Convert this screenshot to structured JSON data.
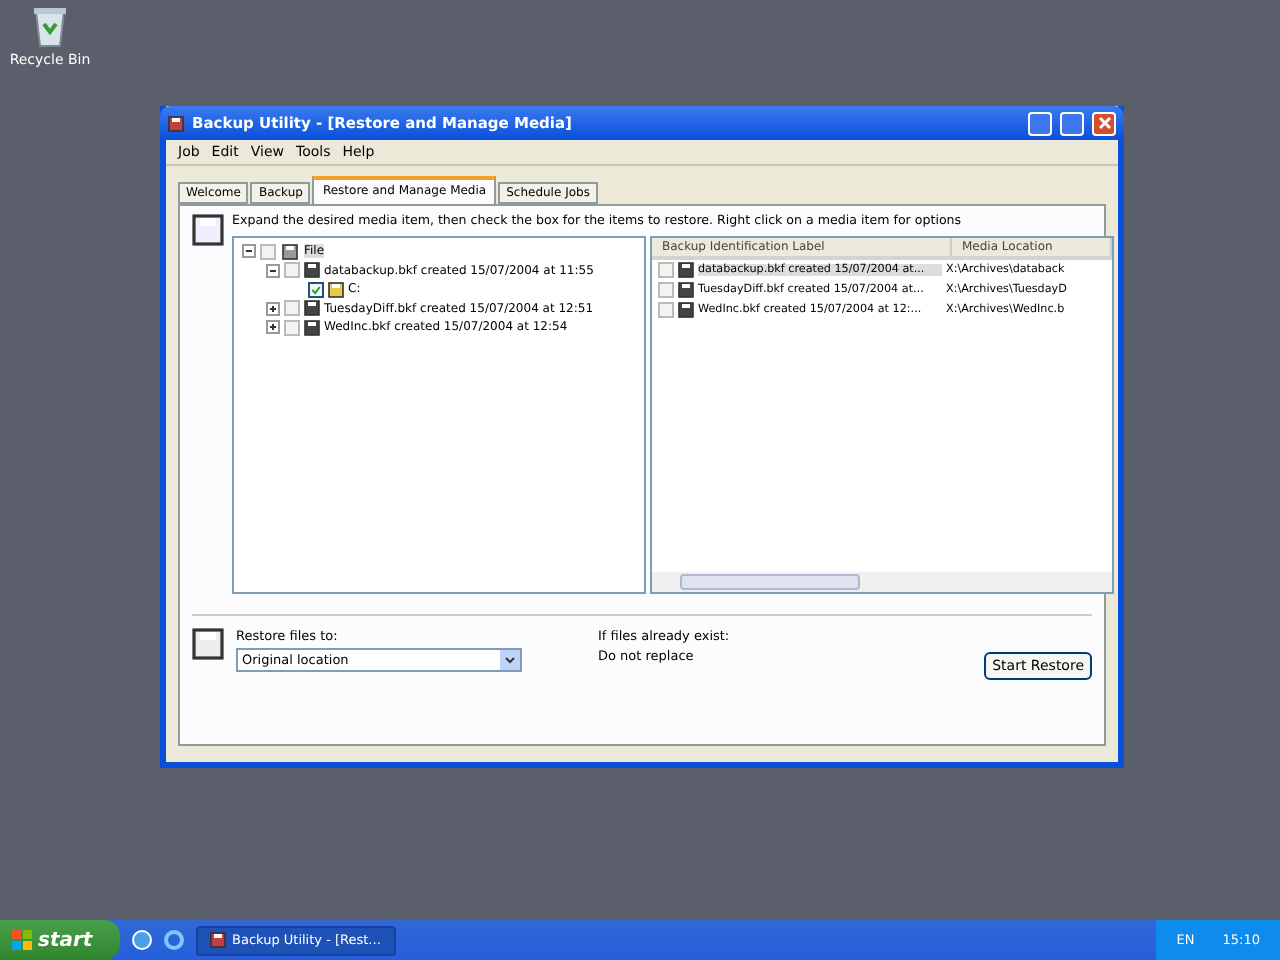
{
  "desktop_icons": [
    {
      "label": "Recycle Bin"
    }
  ],
  "window": {
    "title": "Backup Utility - [Restore and Manage Media]"
  },
  "menu": [
    "Job",
    "Edit",
    "View",
    "Tools",
    "Help"
  ],
  "tabs": [
    {
      "label": "Welcome",
      "selected": false
    },
    {
      "label": "Backup",
      "selected": false
    },
    {
      "label": "Restore and Manage Media",
      "selected": true
    },
    {
      "label": "Schedule Jobs",
      "selected": false
    }
  ],
  "instruction": "Expand the desired media item, then check the box for the items to restore. Right click on a media item for options",
  "tree": [
    {
      "label": "File",
      "kind": "drive",
      "checked": false,
      "expanded": true,
      "selected": true,
      "children": [
        {
          "label": "databackup.bkf created 15/07/2004 at 11:55",
          "kind": "media",
          "checked": false,
          "expanded": true,
          "children": [
            {
              "label": "C:",
              "kind": "folder",
              "checked": true
            }
          ]
        },
        {
          "label": "TuesdayDiff.bkf created 15/07/2004 at 12:51",
          "kind": "media",
          "checked": false,
          "expanded": false
        },
        {
          "label": "WedInc.bkf created 15/07/2004 at 12:54",
          "kind": "media",
          "checked": false,
          "expanded": false
        }
      ]
    }
  ],
  "list": {
    "columns": [
      "Backup Identification Label",
      "Media Location"
    ],
    "rows": [
      {
        "label": "databackup.bkf created 15/07/2004 at...",
        "location": "X:\\Archives\\databack",
        "checked": false,
        "selected": true
      },
      {
        "label": "TuesdayDiff.bkf created 15/07/2004 at...",
        "location": "X:\\Archives\\TuesdayD",
        "checked": false,
        "selected": false
      },
      {
        "label": "WedInc.bkf created 15/07/2004 at 12:...",
        "location": "X:\\Archives\\WedInc.b",
        "checked": false,
        "selected": false
      }
    ]
  },
  "restore_to": {
    "label": "Restore files to:",
    "value": "Original location"
  },
  "if_exists": {
    "label": "If files already exist:",
    "value": "Do not replace"
  },
  "start_button": "Start Restore",
  "taskbar": {
    "start": "start",
    "tasks": [
      {
        "label": "Backup Utility - [Rest...",
        "selected": true
      }
    ],
    "language": "EN",
    "clock": "15:10"
  }
}
